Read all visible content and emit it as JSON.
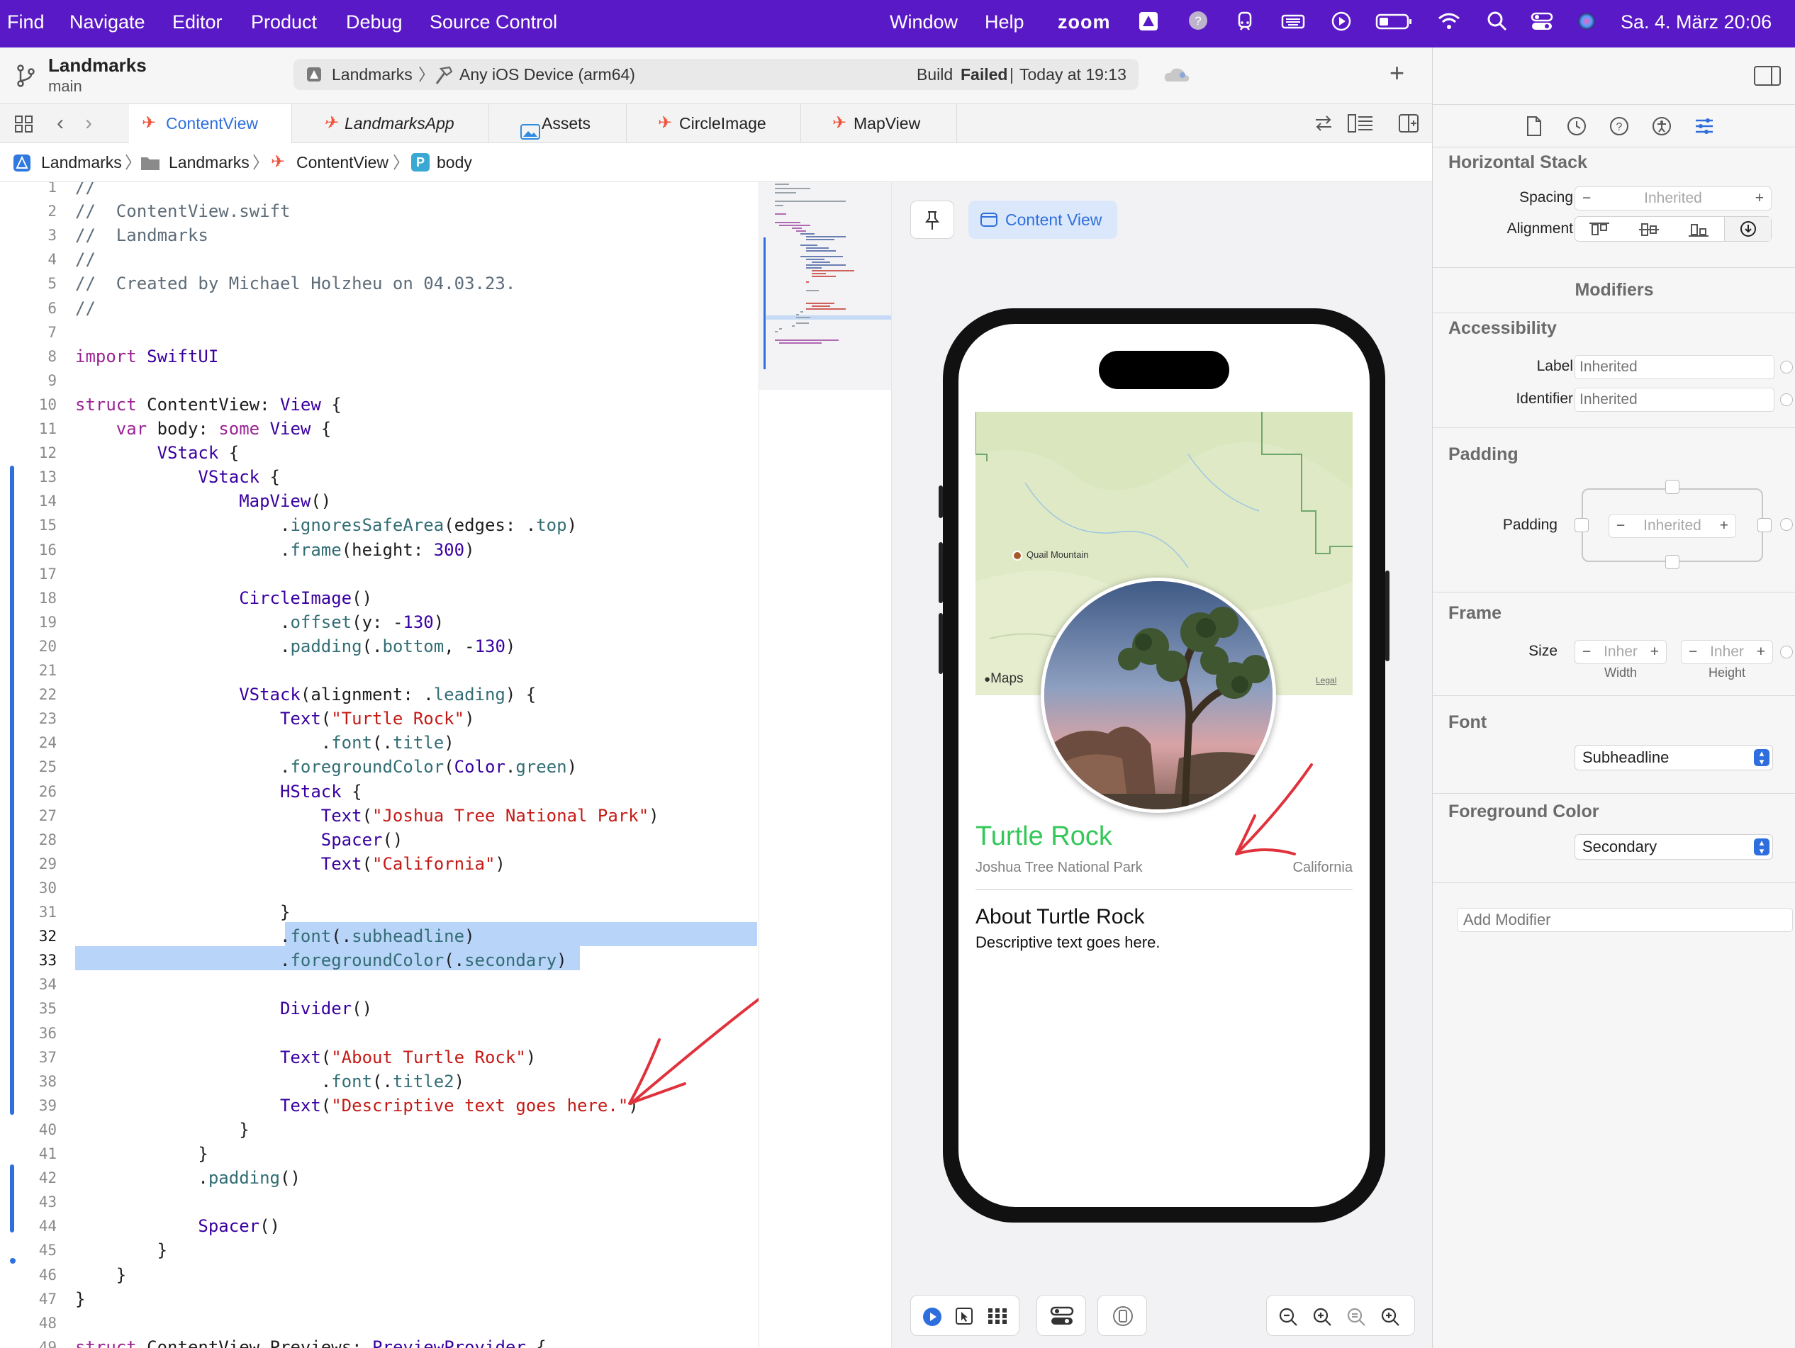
{
  "menubar": {
    "items": [
      "Find",
      "Navigate",
      "Editor",
      "Product",
      "Debug",
      "Source Control"
    ],
    "right_items": [
      "Window",
      "Help",
      "zoom"
    ],
    "datetime": "Sa. 4. März 20:06",
    "icons": [
      "drive-icon",
      "help-bubble-icon",
      "train-icon",
      "keyboard-icon",
      "play-circle-icon",
      "battery-icon",
      "wifi-icon",
      "search-icon",
      "control-center-icon",
      "siri-icon"
    ]
  },
  "toolbar": {
    "project": "Landmarks",
    "branch": "main",
    "scheme": "Landmarks",
    "destination": "Any iOS Device (arm64)",
    "status_prefix": "Build",
    "status_bold": "Failed",
    "status_time": "Today at 19:13"
  },
  "tabs": [
    {
      "label": "ContentView",
      "active": true,
      "icon": "swift-file-icon"
    },
    {
      "label": "LandmarksApp",
      "active": false,
      "icon": "swift-file-icon"
    },
    {
      "label": "Assets",
      "active": false,
      "icon": "asset-catalog-icon"
    },
    {
      "label": "CircleImage",
      "active": false,
      "icon": "swift-file-icon"
    },
    {
      "label": "MapView",
      "active": false,
      "icon": "swift-file-icon"
    }
  ],
  "jumpbar": [
    "Landmarks",
    "Landmarks",
    "ContentView",
    "body"
  ],
  "code_lines": [
    {
      "n": "1",
      "t": "//"
    },
    {
      "n": "2",
      "t": "//  ContentView.swift"
    },
    {
      "n": "3",
      "t": "//  Landmarks"
    },
    {
      "n": "4",
      "t": "//"
    },
    {
      "n": "5",
      "t": "//  Created by Michael Holzheu on 04.03.23."
    },
    {
      "n": "6",
      "t": "//"
    },
    {
      "n": "7",
      "t": ""
    },
    {
      "n": "8",
      "t": "import SwiftUI"
    },
    {
      "n": "9",
      "t": ""
    },
    {
      "n": "10",
      "t": "struct ContentView: View {"
    },
    {
      "n": "11",
      "t": "    var body: some View {"
    },
    {
      "n": "12",
      "t": "        VStack {"
    },
    {
      "n": "13",
      "t": "            VStack {"
    },
    {
      "n": "14",
      "t": "                MapView()"
    },
    {
      "n": "15",
      "t": "                    .ignoresSafeArea(edges: .top)"
    },
    {
      "n": "16",
      "t": "                    .frame(height: 300)"
    },
    {
      "n": "17",
      "t": ""
    },
    {
      "n": "18",
      "t": "                CircleImage()"
    },
    {
      "n": "19",
      "t": "                    .offset(y: -130)"
    },
    {
      "n": "20",
      "t": "                    .padding(.bottom, -130)"
    },
    {
      "n": "21",
      "t": ""
    },
    {
      "n": "22",
      "t": "                VStack(alignment: .leading) {"
    },
    {
      "n": "23",
      "t": "                    Text(\"Turtle Rock\")"
    },
    {
      "n": "24",
      "t": "                        .font(.title)"
    },
    {
      "n": "25",
      "t": "                    .foregroundColor(Color.green)"
    },
    {
      "n": "26",
      "t": "                    HStack {"
    },
    {
      "n": "27",
      "t": "                        Text(\"Joshua Tree National Park\")"
    },
    {
      "n": "28",
      "t": "                        Spacer()"
    },
    {
      "n": "29",
      "t": "                        Text(\"California\")"
    },
    {
      "n": "30",
      "t": ""
    },
    {
      "n": "31",
      "t": "                    }"
    },
    {
      "n": "32",
      "t": "                    .font(.subheadline)"
    },
    {
      "n": "33",
      "t": "                    .foregroundColor(.secondary)"
    },
    {
      "n": "34",
      "t": ""
    },
    {
      "n": "35",
      "t": "                    Divider()"
    },
    {
      "n": "36",
      "t": ""
    },
    {
      "n": "37",
      "t": "                    Text(\"About Turtle Rock\")"
    },
    {
      "n": "38",
      "t": "                        .font(.title2)"
    },
    {
      "n": "39",
      "t": "                    Text(\"Descriptive text goes here.\")"
    },
    {
      "n": "40",
      "t": "                }"
    },
    {
      "n": "41",
      "t": "            }"
    },
    {
      "n": "42",
      "t": "            .padding()"
    },
    {
      "n": "43",
      "t": ""
    },
    {
      "n": "44",
      "t": "            Spacer()"
    },
    {
      "n": "45",
      "t": "        }"
    },
    {
      "n": "46",
      "t": "    }"
    },
    {
      "n": "47",
      "t": "}"
    },
    {
      "n": "48",
      "t": ""
    },
    {
      "n": "49",
      "t": "struct ContentView_Previews: PreviewProvider {"
    }
  ],
  "canvas": {
    "pin_label": "pin-icon",
    "content_view_label": "Content View",
    "preview": {
      "title": "Turtle Rock",
      "park": "Joshua Tree National Park",
      "state": "California",
      "about": "About Turtle Rock",
      "description": "Descriptive text goes here.",
      "map_place": "Quail Mountain",
      "map_brand": "Maps",
      "map_legal": "Legal",
      "title_color": "#34c759"
    }
  },
  "inspector": {
    "stack_title": "Horizontal Stack",
    "spacing_label": "Spacing",
    "spacing_value": "Inherited",
    "alignment_label": "Alignment",
    "modifiers_title": "Modifiers",
    "accessibility_title": "Accessibility",
    "a11y_label": "Label",
    "a11y_label_placeholder": "Inherited",
    "a11y_identifier": "Identifier",
    "a11y_identifier_placeholder": "Inherited",
    "padding_title": "Padding",
    "padding_label": "Padding",
    "padding_value": "Inherited",
    "frame_title": "Frame",
    "size_label": "Size",
    "width_value": "Inher",
    "height_value": "Inher",
    "width_label": "Width",
    "height_label": "Height",
    "font_title": "Font",
    "font_value": "Subheadline",
    "fg_title": "Foreground Color",
    "fg_value": "Secondary",
    "add_modifier_placeholder": "Add Modifier"
  },
  "colors": {
    "menubar": "#5a19c6",
    "accent": "#2f6fdd",
    "selection": "#b8d4f8",
    "annotation": "#e0323c"
  }
}
